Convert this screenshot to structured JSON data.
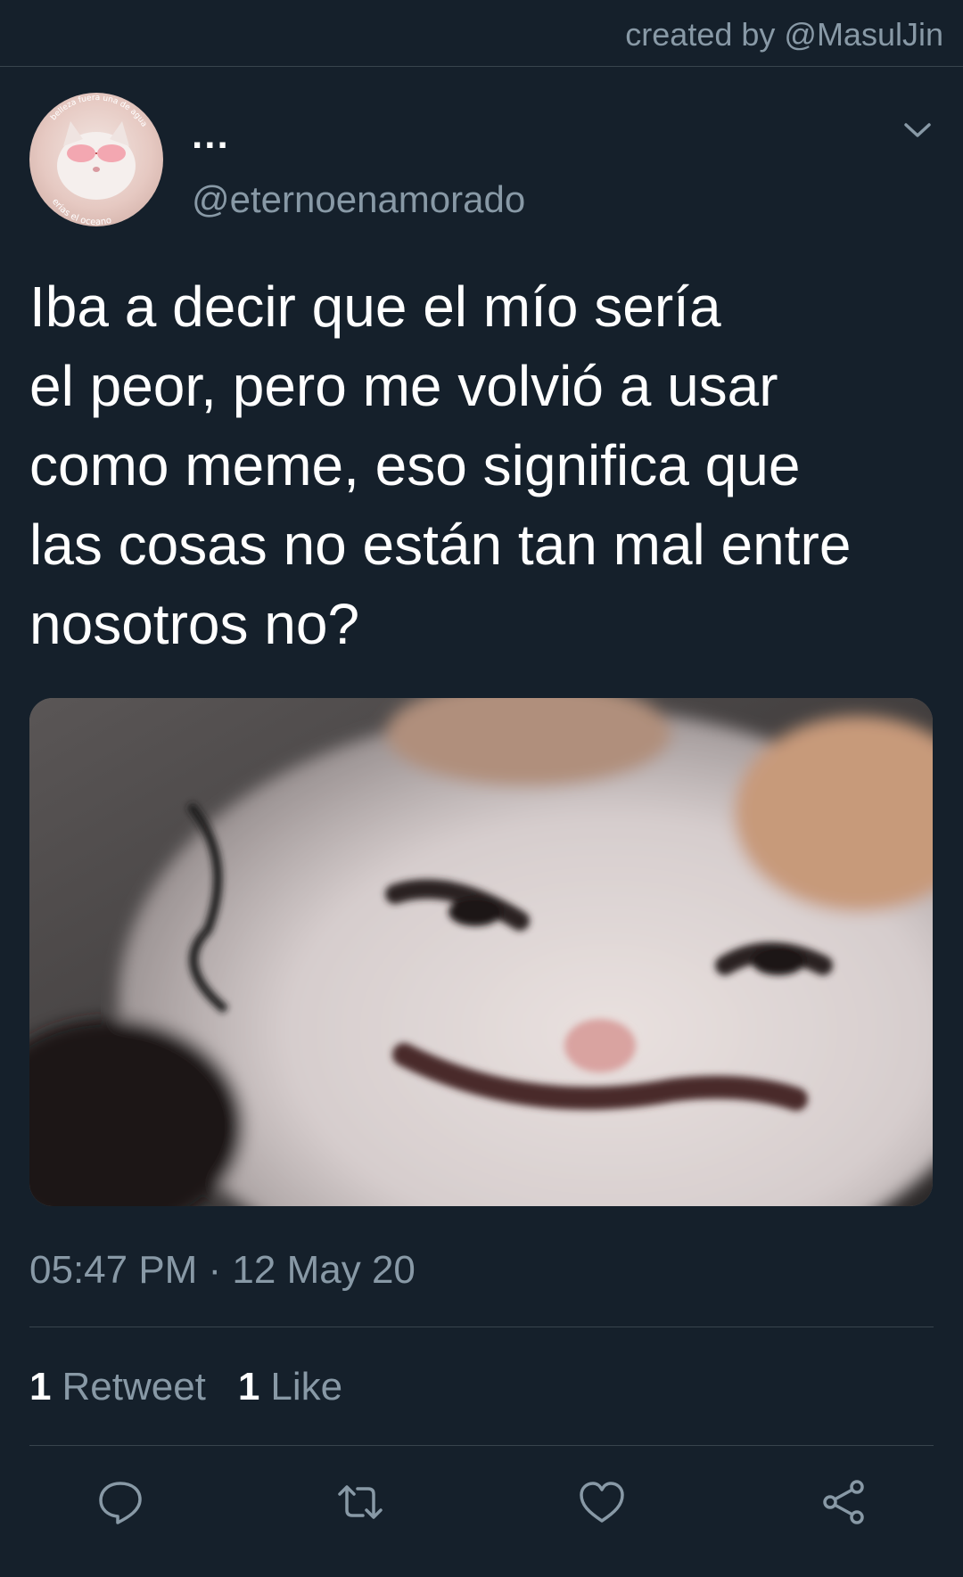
{
  "watermark": "created by @MasulJin",
  "author": {
    "display_name": "...",
    "handle": "@eternoenamorado",
    "avatar": {
      "icon": "cat-avatar",
      "text_top": "belleza fuera una de agua",
      "text_bottom": "erias el oceano"
    }
  },
  "menu_icon": "chevron-down-icon",
  "tweet": {
    "text": "Iba a decir que el mío sería\nel peor, pero me volvió a usar\ncomo meme, eso significa que\nlas cosas no están tan mal entre\nnosotros no?",
    "media_icon": "crying-cat-photo",
    "timestamp": "05:47 PM · 12 May 20",
    "retweet_count": "1",
    "retweet_label": "Retweet",
    "like_count": "1",
    "like_label": "Like"
  },
  "actions": [
    {
      "icon": "reply-icon"
    },
    {
      "icon": "retweet-icon"
    },
    {
      "icon": "like-heart-icon"
    },
    {
      "icon": "share-icon"
    }
  ],
  "colors": {
    "background": "#15202b",
    "secondary_text": "#8899a6",
    "divider": "#38444d",
    "primary_text": "#ffffff"
  }
}
